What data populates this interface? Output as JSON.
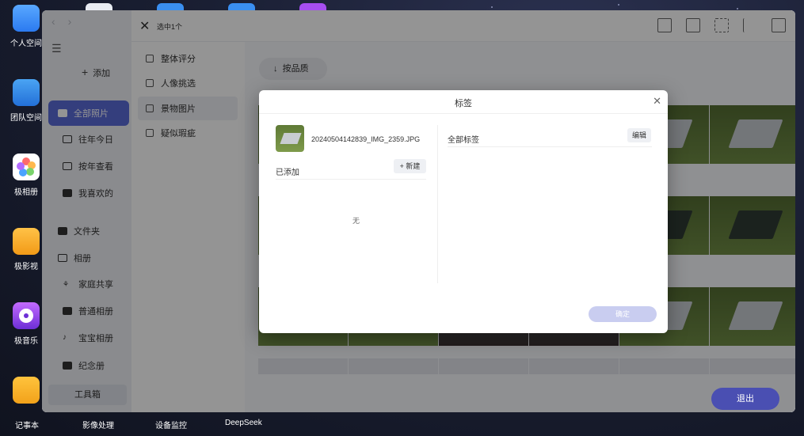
{
  "desktop": {
    "icons": [
      {
        "label": "个人空间",
        "icon": "folder-icon"
      },
      {
        "label": "团队空间",
        "icon": "team-folder-icon"
      },
      {
        "label": "极相册",
        "icon": "photos-icon"
      },
      {
        "label": "极影视",
        "icon": "video-icon"
      },
      {
        "label": "极音乐",
        "icon": "music-icon"
      },
      {
        "label": "记事本",
        "icon": "notes-icon"
      }
    ],
    "taskbar": [
      "影像处理",
      "设备监控",
      "DeepSeek"
    ]
  },
  "sidebar": {
    "add_label": "添加",
    "items": [
      {
        "label": "全部照片",
        "active": true
      },
      {
        "label": "往年今日"
      },
      {
        "label": "按年查看"
      },
      {
        "label": "我喜欢的"
      },
      {
        "label": "文件夹"
      },
      {
        "label": "相册"
      },
      {
        "label": "家庭共享"
      },
      {
        "label": "普通相册"
      },
      {
        "label": "宝宝相册"
      },
      {
        "label": "纪念册"
      }
    ],
    "tools_label": "工具箱"
  },
  "toolbar": {
    "selected_text": "选中1个",
    "icons": [
      "share-icon",
      "add-image-icon",
      "select-icon",
      "flag-icon",
      "trash-icon"
    ]
  },
  "filters": [
    {
      "label": "整体评分"
    },
    {
      "label": "人像挑选"
    },
    {
      "label": "景物图片",
      "active": true
    },
    {
      "label": "疑似瑕疵"
    }
  ],
  "grid": {
    "sort_label": "按品质"
  },
  "exit_label": "退出",
  "modal": {
    "title": "标签",
    "filename": "20240504142839_IMG_2359.JPG",
    "added_label": "已添加",
    "new_label": "+ 新建",
    "empty_text": "无",
    "all_tags_label": "全部标签",
    "edit_label": "编辑",
    "ok_label": "确定"
  }
}
